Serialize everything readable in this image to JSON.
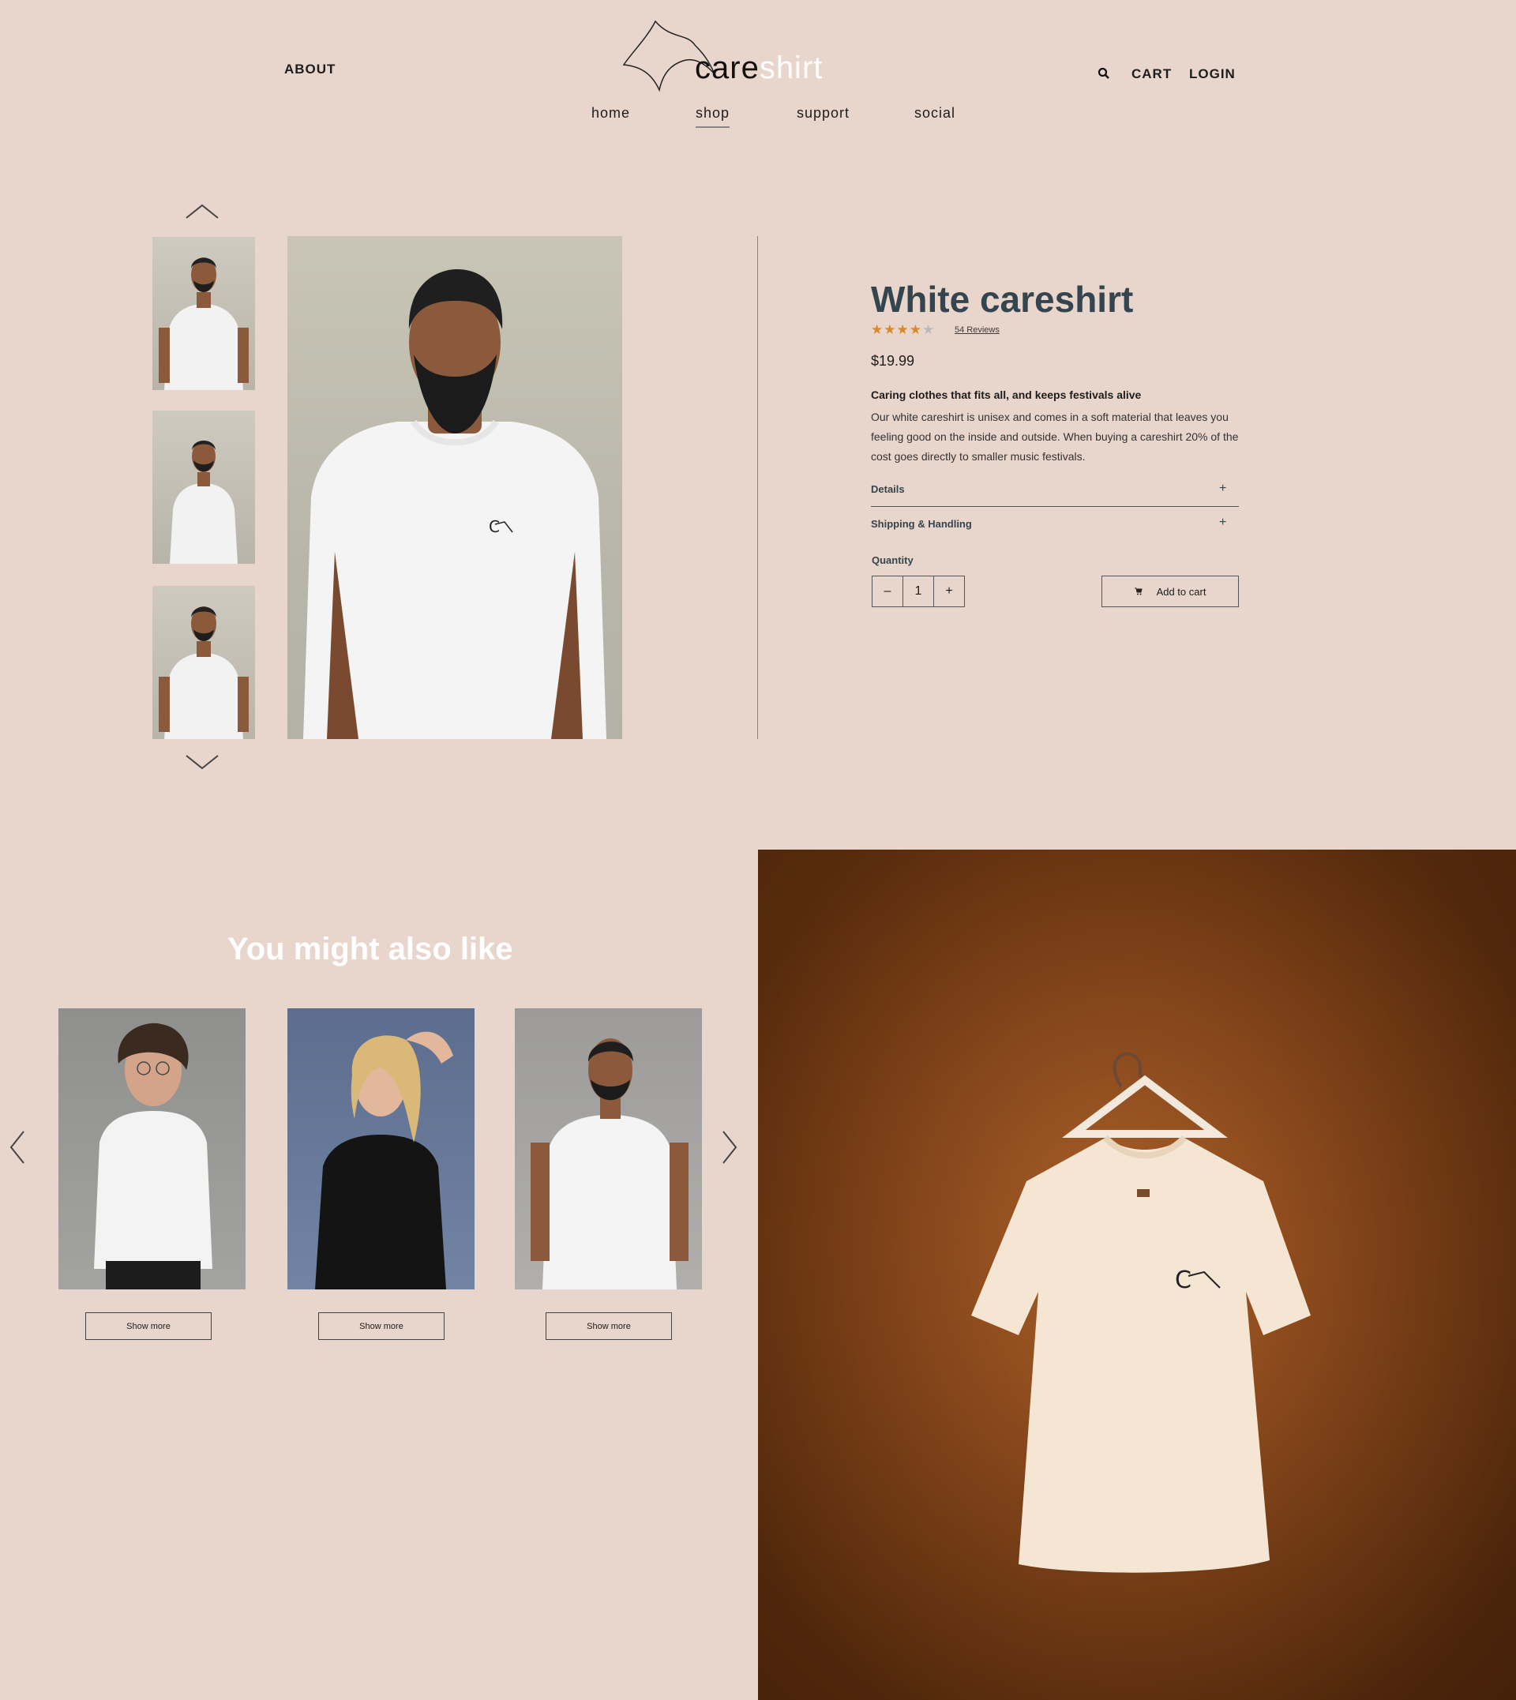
{
  "header": {
    "about": "ABOUT",
    "logo_care": "care",
    "logo_shirt": "shirt",
    "cart": "CART",
    "login": "LOGIN",
    "nav": [
      "home",
      "shop",
      "support",
      "social"
    ],
    "active_nav": "shop"
  },
  "product": {
    "title": "White careshirt",
    "rating": 4,
    "rating_max": 5,
    "reviews": "54 Reviews",
    "price": "$19.99",
    "tagline": "Caring clothes that fits all, and keeps festivals alive",
    "description": "Our white careshirt is unisex and comes in a soft material that leaves you feeling good on the inside and outside. When buying a careshirt 20% of the cost goes directly to smaller music festivals.",
    "accordion": [
      {
        "label": "Details",
        "icon": "+"
      },
      {
        "label": "Shipping & Handling",
        "icon": "+"
      }
    ],
    "quantity_label": "Quantity",
    "quantity_value": "1",
    "minus": "–",
    "plus": "+",
    "add_to_cart": "Add to cart"
  },
  "recommendations": {
    "title": "You might also like",
    "button_label": "Show more"
  },
  "colors": {
    "background": "#e8d5cb",
    "title": "#34454f",
    "star": "#d7892d"
  }
}
